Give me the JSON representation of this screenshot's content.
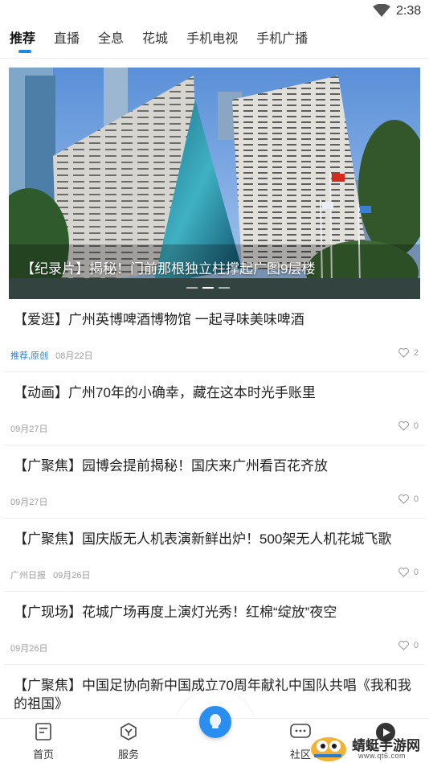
{
  "status_bar": {
    "time": "2:38"
  },
  "tabs": [
    {
      "label": "推荐",
      "active": true
    },
    {
      "label": "直播"
    },
    {
      "label": "全息"
    },
    {
      "label": "花城"
    },
    {
      "label": "手机电视"
    },
    {
      "label": "手机广播"
    }
  ],
  "banner": {
    "caption": "【纪录片】揭秘！门前那根独立柱撑起广图9层楼",
    "dots": 3,
    "active_dot": 1
  },
  "news": [
    {
      "title": "【爱逛】广州英博啤酒博物馆 一起寻味美味啤酒",
      "source": "推荐,原创",
      "source_highlight": true,
      "date": "08月22日",
      "likes": "2"
    },
    {
      "title": "【动画】广州70年的小确幸，藏在这本时光手账里",
      "source": "",
      "date": "09月27日",
      "likes": "0"
    },
    {
      "title": "【广聚焦】园博会提前揭秘！国庆来广州看百花齐放",
      "source": "",
      "date": "09月27日",
      "likes": "0"
    },
    {
      "title": "【广聚焦】国庆版无人机表演新鲜出炉！500架无人机花城飞歌",
      "source": "广州日报",
      "date": "09月26日",
      "likes": "0"
    },
    {
      "title": "【广现场】花城广场再度上演灯光秀！红棉“绽放”夜空",
      "source": "",
      "date": "09月26日",
      "likes": "0"
    },
    {
      "title": "【广聚焦】中国足协向新中国成立70周年献礼中国队共唱《我和我的祖国》",
      "source": "",
      "date": "",
      "likes": ""
    }
  ],
  "bottom_nav": {
    "home": "首页",
    "service": "服务",
    "community": "社区"
  },
  "watermark": {
    "text": "蜻蜓手游网",
    "url": "www.qt6.com"
  },
  "colors": {
    "accent": "#1e88e5",
    "center_button": "#2a8ef0"
  }
}
